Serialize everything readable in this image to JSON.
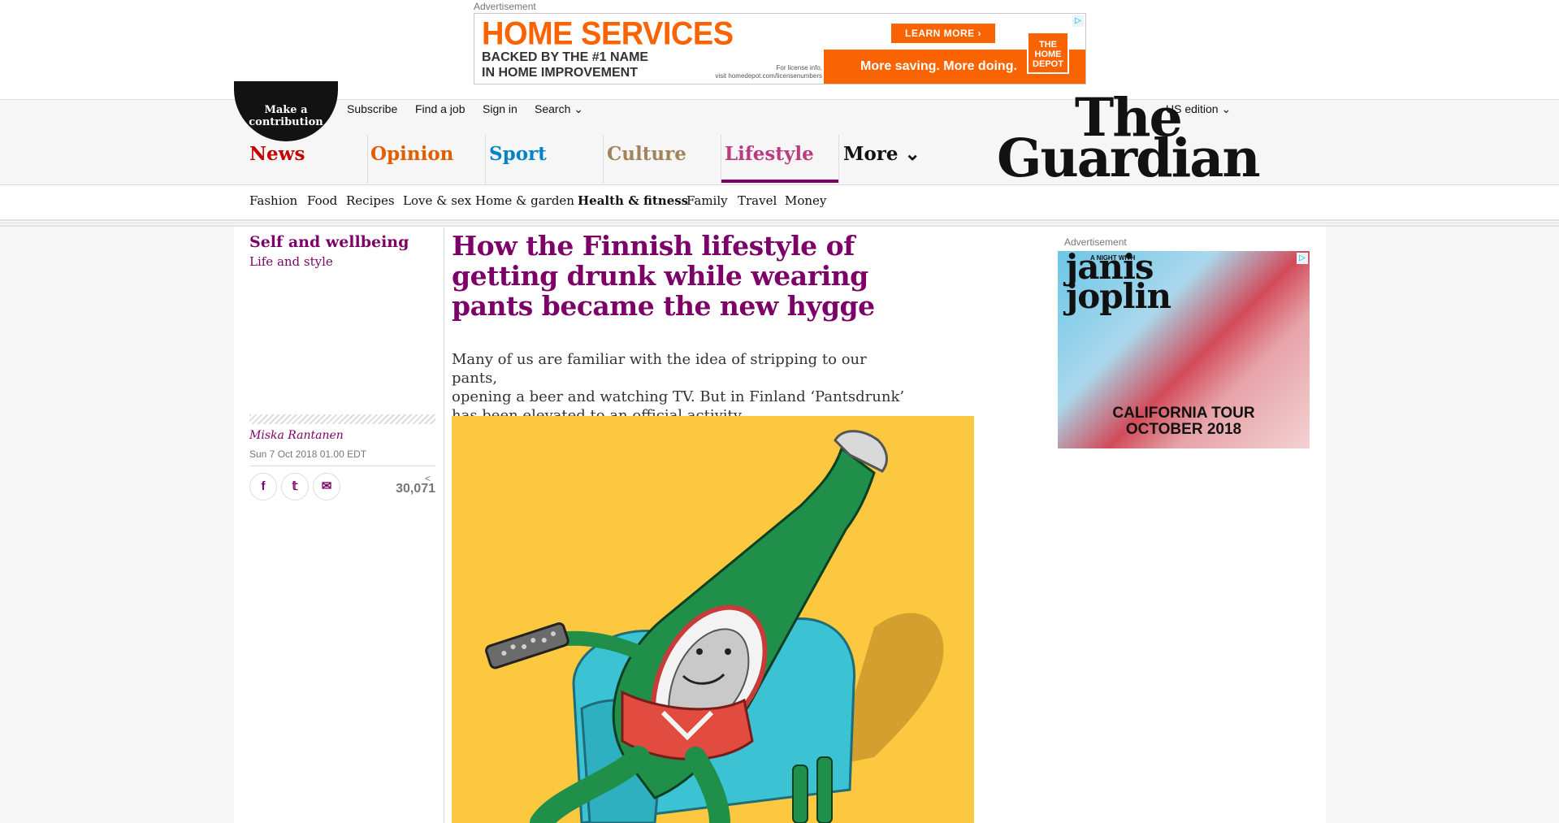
{
  "top_ad": {
    "label": "Advertisement",
    "title": "HOME SERVICES",
    "subtitle_line1": "BACKED BY THE #1 NAME",
    "subtitle_line2": "IN HOME IMPROVEMENT",
    "fine_line1": "For license info,",
    "fine_line2": "visit homedepot.com/licensenumbers",
    "cta": "LEARN MORE ›",
    "tagline": "More saving. More doing.",
    "logo_text": "THE HOME DEPOT",
    "adchoice": "▷",
    "colors": {
      "orange": "#f96302"
    }
  },
  "header": {
    "contribute": "Make a contribution",
    "top_links": [
      "Subscribe",
      "Find a job",
      "Sign in",
      "Search ⌄"
    ],
    "edition": "US edition ⌄",
    "logo_line1": "The",
    "logo_line2": "Guardian",
    "pillars": [
      {
        "label": "News",
        "color": "#c70000"
      },
      {
        "label": "Opinion",
        "color": "#e05e00"
      },
      {
        "label": "Sport",
        "color": "#0084c6"
      },
      {
        "label": "Culture",
        "color": "#a1845c"
      },
      {
        "label": "Lifestyle",
        "color": "#bb3b80"
      },
      {
        "label": "More ⌄",
        "color": "#121212"
      }
    ],
    "active_pillar": "Lifestyle"
  },
  "subnav": {
    "items": [
      "Fashion",
      "Food",
      "Recipes",
      "Love & sex",
      "Home & garden",
      "Health & fitness",
      "Family",
      "Travel",
      "Money"
    ],
    "active": "Health & fitness"
  },
  "article": {
    "section": "Self and wellbeing",
    "subsection": "Life and style",
    "headline": "How the Finnish lifestyle of getting drunk while wearing pants became the new hygge",
    "standfirst_line1": "Many of us are familiar with the idea of stripping to our pants,",
    "standfirst_line2": "opening a beer and watching TV. But in Finland ‘Pantsdrunk’",
    "standfirst_line3": "has been elevated to an official activity",
    "author": "Miska Rantanen",
    "date": "Sun 7 Oct 2018 01.00 EDT",
    "shares": "30,071",
    "share_buttons": [
      "f",
      "𝕥",
      "✉"
    ],
    "share_icon": "<"
  },
  "side_ad": {
    "label": "Advertisement",
    "small_text": "A NIGHT WITH",
    "name_line1": "janis",
    "name_line2": "joplin",
    "tour_line1": "CALIFORNIA TOUR",
    "tour_line2": "OCTOBER 2018",
    "adchoice": "▷"
  }
}
